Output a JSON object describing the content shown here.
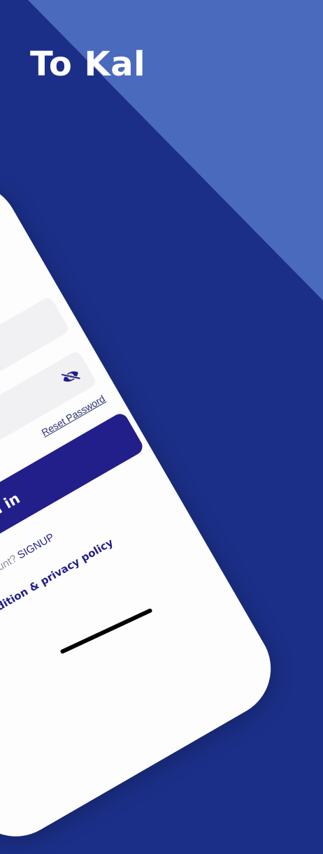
{
  "headline": "To Kal",
  "login": {
    "username_placeholder": "",
    "password_placeholder": "",
    "reset_password": "Reset Password",
    "sign_in": "sign in",
    "account_prompt": "Don't have account? ",
    "signup": "SIGNUP",
    "terms": "Terms condition & privacy policy"
  },
  "icons": {
    "password_toggle": "eye-slash-icon"
  },
  "colors": {
    "background_dark": "#1b2f88",
    "background_light": "#4a6bbd",
    "button": "#221e8a"
  }
}
